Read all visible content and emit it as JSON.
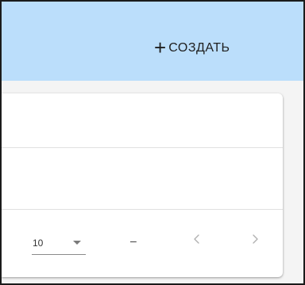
{
  "toolbar": {
    "create_label": "СОЗДАТЬ",
    "create_icon": "plus-icon"
  },
  "pagination": {
    "page_size": "10",
    "page_size_icon": "chevron-down-icon",
    "range": "–",
    "prev_icon": "chevron-left-icon",
    "next_icon": "chevron-right-icon"
  },
  "colors": {
    "toolbar_background": "#bbdefb",
    "panel_background": "#ffffff",
    "page_background": "#f4f4f4",
    "disabled_icon": "#b0b0b0"
  }
}
